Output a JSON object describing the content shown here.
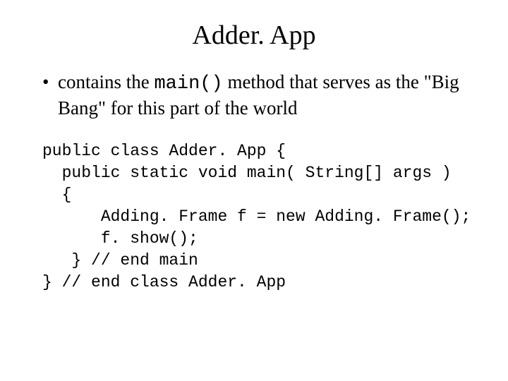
{
  "title": "Adder. App",
  "bullet": {
    "pre": "contains the ",
    "code": "main()",
    "post": " method that serves as the \"Big Bang\" for this part of the world"
  },
  "code": {
    "l1": "public class Adder. App {",
    "l2": "  public static void main( String[] args )",
    "l3": "  {",
    "l4": "      Adding. Frame f = new Adding. Frame();",
    "l5": "      f. show();",
    "l6": "   } // end main",
    "l7": "} // end class Adder. App"
  }
}
